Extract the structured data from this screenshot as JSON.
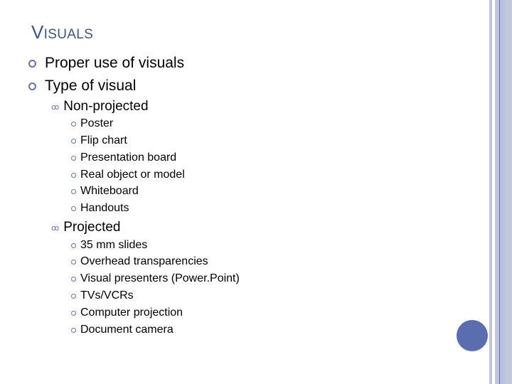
{
  "slide": {
    "title_first": "V",
    "title_rest": "ISUALS",
    "bullets": [
      {
        "text": "Proper use of visuals"
      },
      {
        "text": "Type of visual"
      }
    ],
    "non_projected": {
      "label": "Non-projected",
      "items": [
        "Poster",
        "Flip chart",
        "Presentation board",
        "Real object or model",
        "Whiteboard",
        "Handouts"
      ]
    },
    "projected": {
      "label": "Projected",
      "items": [
        "35 mm slides",
        "Overhead transparencies",
        "Visual presenters (Power.Point)",
        "TVs/VCRs",
        "Computer projection",
        "Document camera"
      ]
    }
  },
  "colors": {
    "title": "#3b5683",
    "bullet": "#6673a6",
    "accent_circle": "#5a6eaf",
    "stripe_light": "#c0c5dc",
    "stripe_dark": "#5a6a9a"
  }
}
